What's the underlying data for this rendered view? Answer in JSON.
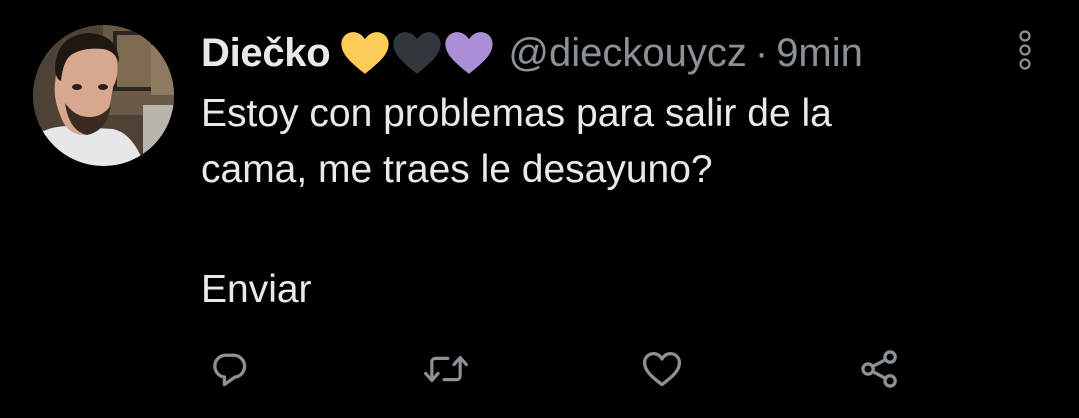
{
  "tweet": {
    "display_name": "Diečko",
    "handle": "@dieckouycz",
    "separator": "·",
    "time": "9min",
    "text_line_1": "Estoy con problemas para salir de la",
    "text_line_2": "cama, me traes le desayuno?",
    "text_line_3": "Enviar",
    "name_hearts": [
      {
        "icon": "yellow-heart-icon",
        "color": "#fdcb58"
      },
      {
        "icon": "black-heart-icon",
        "color": "#31373d"
      },
      {
        "icon": "purple-heart-icon",
        "color": "#aa8ed6"
      }
    ]
  },
  "actions": [
    {
      "icon": "reply-icon"
    },
    {
      "icon": "retweet-icon"
    },
    {
      "icon": "like-icon"
    },
    {
      "icon": "share-icon"
    }
  ],
  "colors": {
    "background": "#000000",
    "primary_text": "#e7e9ea",
    "secondary_text": "#8b9196",
    "icon_gray": "#8b9196"
  }
}
